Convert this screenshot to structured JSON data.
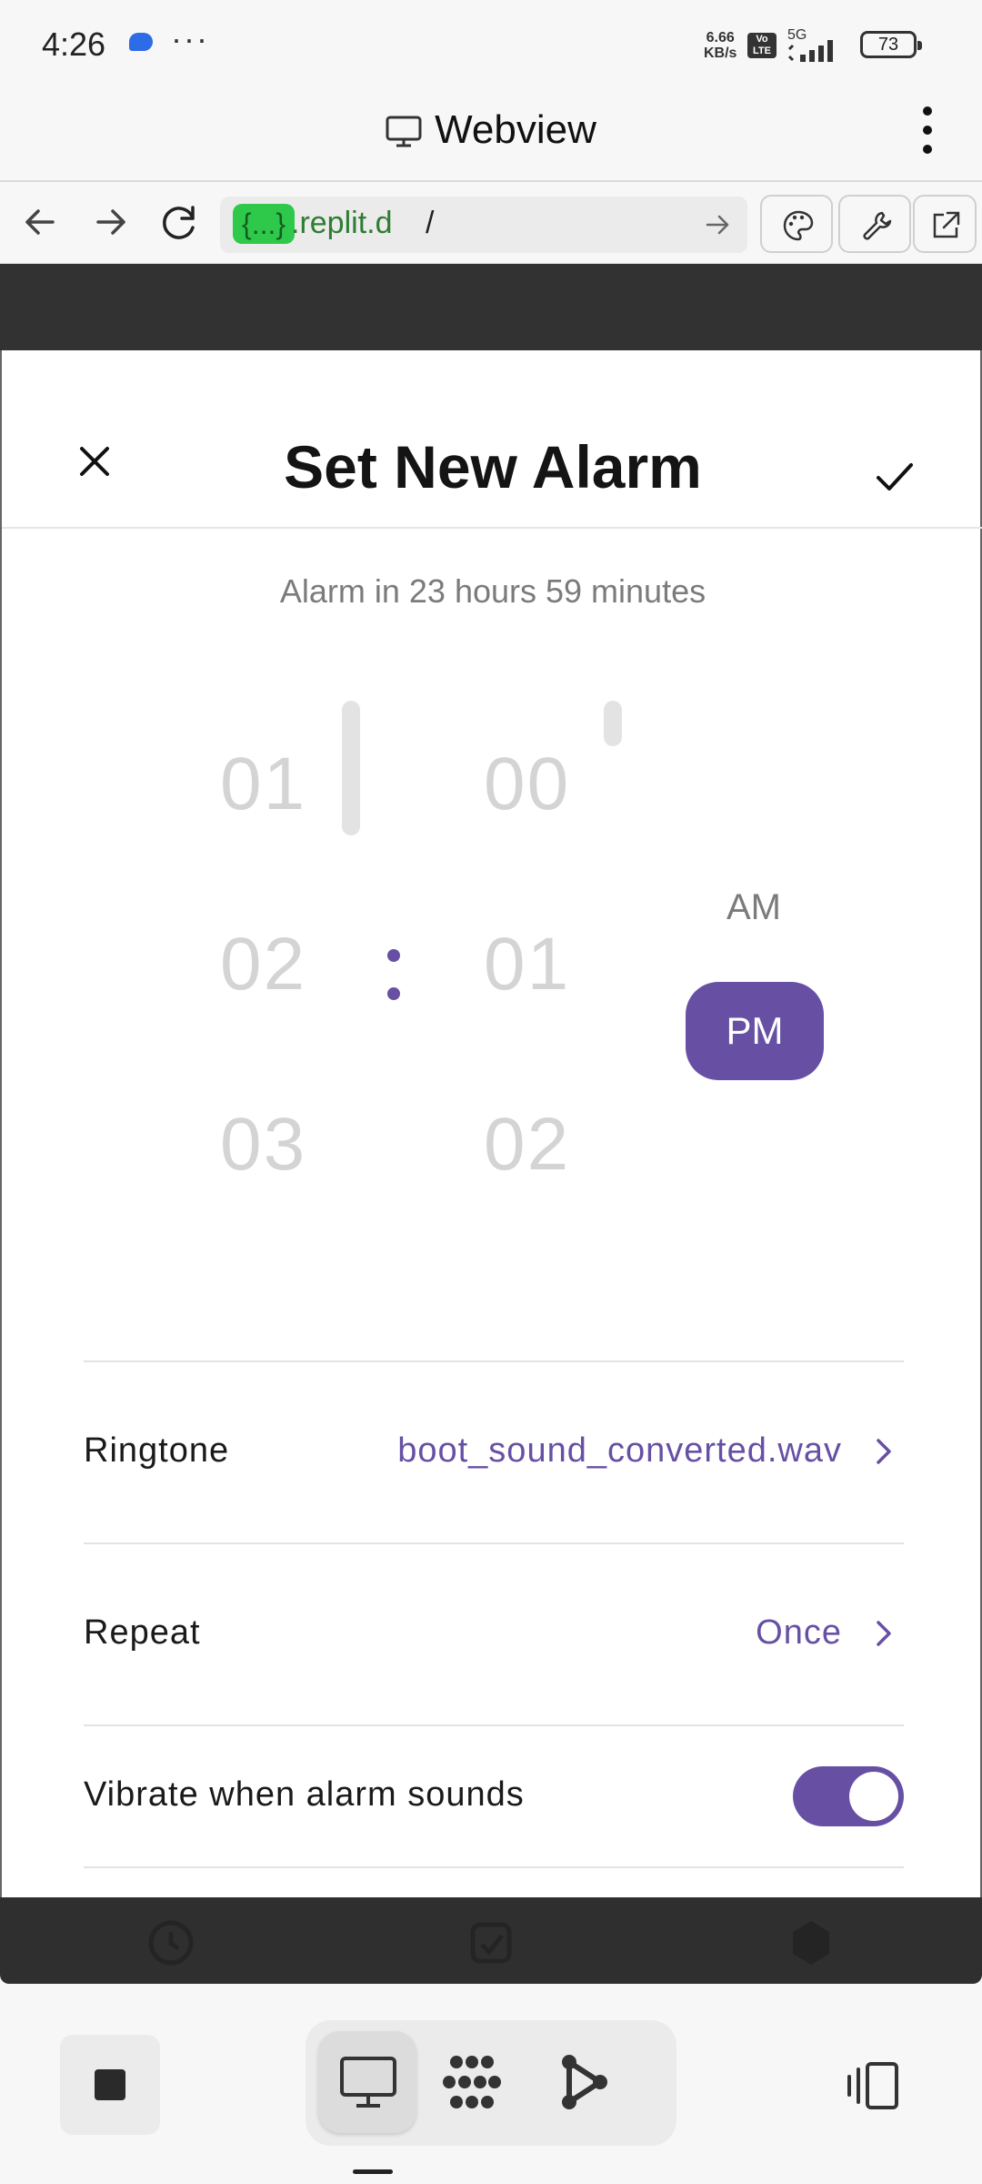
{
  "status_bar": {
    "time": "4:26",
    "net_speed_value": "6.66",
    "net_speed_unit": "KB/s",
    "volte": "Vo LTE",
    "network": "5G",
    "battery": "73"
  },
  "browser": {
    "title": "Webview",
    "url_tag": "{...}",
    "url_host": ".replit.d",
    "url_path": "/"
  },
  "alarm": {
    "title": "Set New Alarm",
    "subtitle": "Alarm in 23 hours 59 minutes",
    "hours": [
      "01",
      "02",
      "03"
    ],
    "minutes": [
      "00",
      "01",
      "02"
    ],
    "colon": ":",
    "am_label": "AM",
    "pm_label": "PM",
    "selected_period": "PM",
    "settings": {
      "ringtone_label": "Ringtone",
      "ringtone_value": "boot_sound_converted.wav",
      "repeat_label": "Repeat",
      "repeat_value": "Once",
      "vibrate_label": "Vibrate when alarm sounds",
      "vibrate_on": true
    }
  },
  "colors": {
    "accent": "#6750a4",
    "url_tag": "#2ec94a",
    "url_host": "#2e7d32"
  },
  "icons": [
    "monitor-icon",
    "more-vert-icon",
    "back-arrow-icon",
    "forward-arrow-icon",
    "reload-icon",
    "go-arrow-icon",
    "palette-icon",
    "wrench-icon",
    "open-external-icon",
    "close-icon",
    "check-icon",
    "chevron-right-icon",
    "stop-icon",
    "webview-icon",
    "devtools-icon",
    "ai-nodes-icon",
    "split-view-icon"
  ]
}
